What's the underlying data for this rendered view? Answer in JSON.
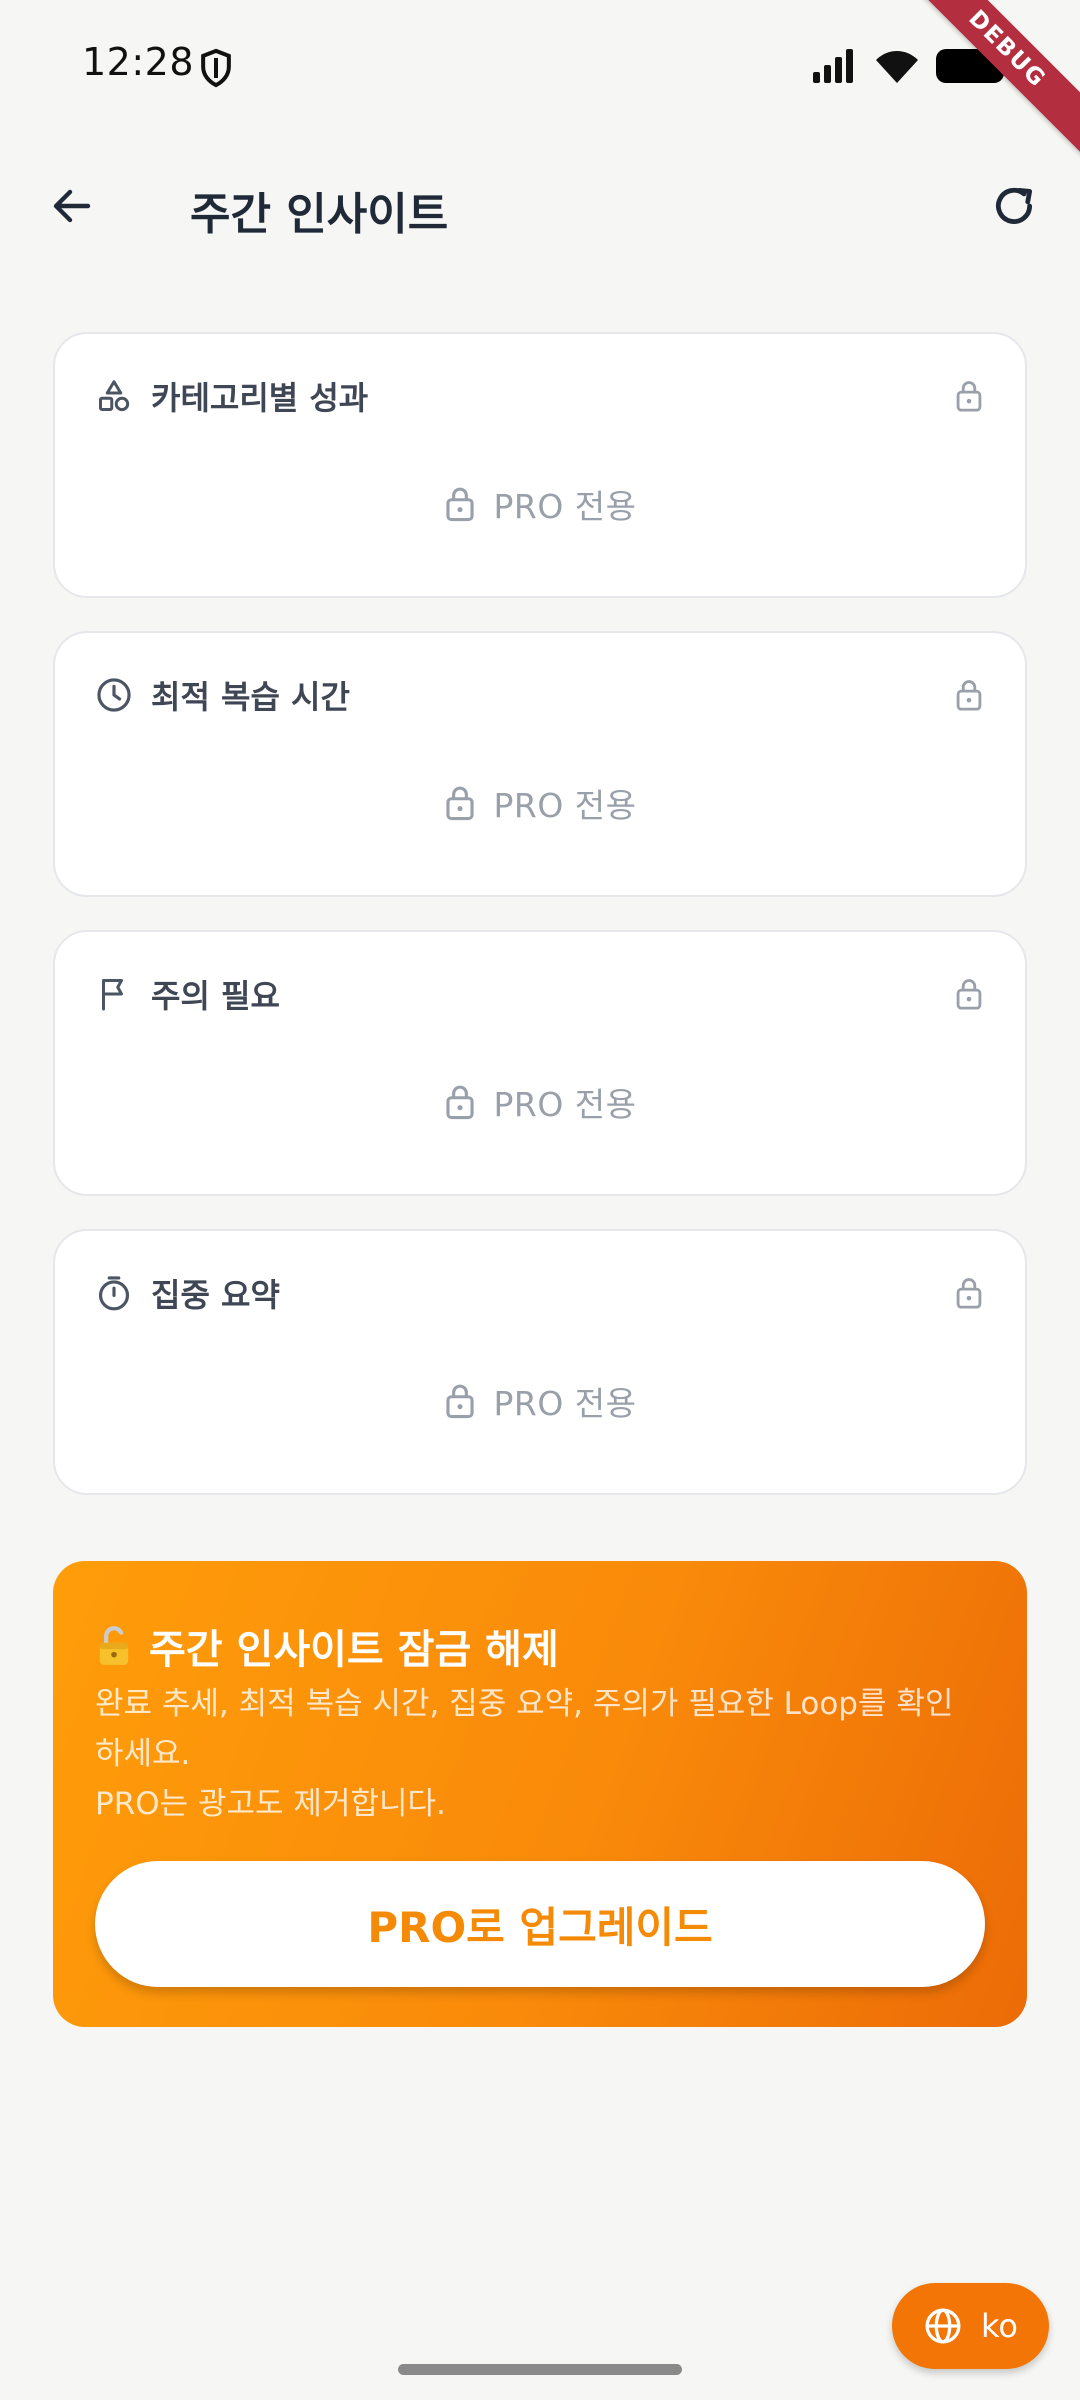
{
  "status_bar": {
    "time": "12:28",
    "icons": [
      "shield-icon",
      "signal-icon",
      "wifi-icon",
      "battery-icon"
    ]
  },
  "debug_banner": {
    "label": "DEBUG",
    "color": "#b32f3f"
  },
  "app_bar": {
    "title": "주간 인사이트",
    "back_icon": "arrow-left-icon",
    "refresh_icon": "refresh-icon"
  },
  "cards": [
    {
      "title": "카테고리별 성과",
      "icon": "shapes-icon",
      "locked_label": "PRO 전용"
    },
    {
      "title": "최적 복습 시간",
      "icon": "clock-icon",
      "locked_label": "PRO 전용"
    },
    {
      "title": "주의 필요",
      "icon": "flag-icon",
      "locked_label": "PRO 전용"
    },
    {
      "title": "집중 요약",
      "icon": "timer-icon",
      "locked_label": "PRO 전용"
    }
  ],
  "promo": {
    "title": "주간 인사이트 잠금 해제",
    "description_lines": [
      "완료 추세, 최적 복습 시간, 집중 요약, 주의가 필요한 Loop를 확인",
      "하세요.",
      "PRO는 광고도 제거합니다."
    ],
    "button_label": "PRO로 업그레이드",
    "accent_color": "#f98a0a"
  },
  "language_fab": {
    "label": "ko",
    "icon": "globe-icon"
  }
}
